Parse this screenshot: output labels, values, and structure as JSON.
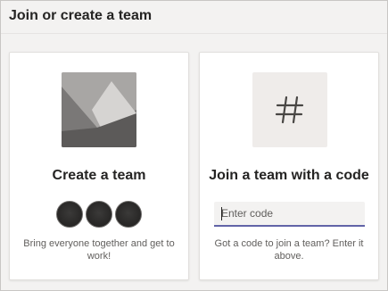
{
  "header": {
    "title": "Join or create a team"
  },
  "create_card": {
    "title": "Create a team",
    "description": "Bring everyone together and get to work!",
    "image_icon": "landscape-image-icon",
    "avatar_count": 3
  },
  "join_card": {
    "title": "Join a team with a code",
    "input_placeholder": "Enter code",
    "description": "Got a code to join a team? Enter it above.",
    "icon": "hash-icon",
    "icon_glyph": "#"
  },
  "colors": {
    "accent": "#6264a7",
    "background": "#f3f2f1",
    "card": "#ffffff"
  }
}
